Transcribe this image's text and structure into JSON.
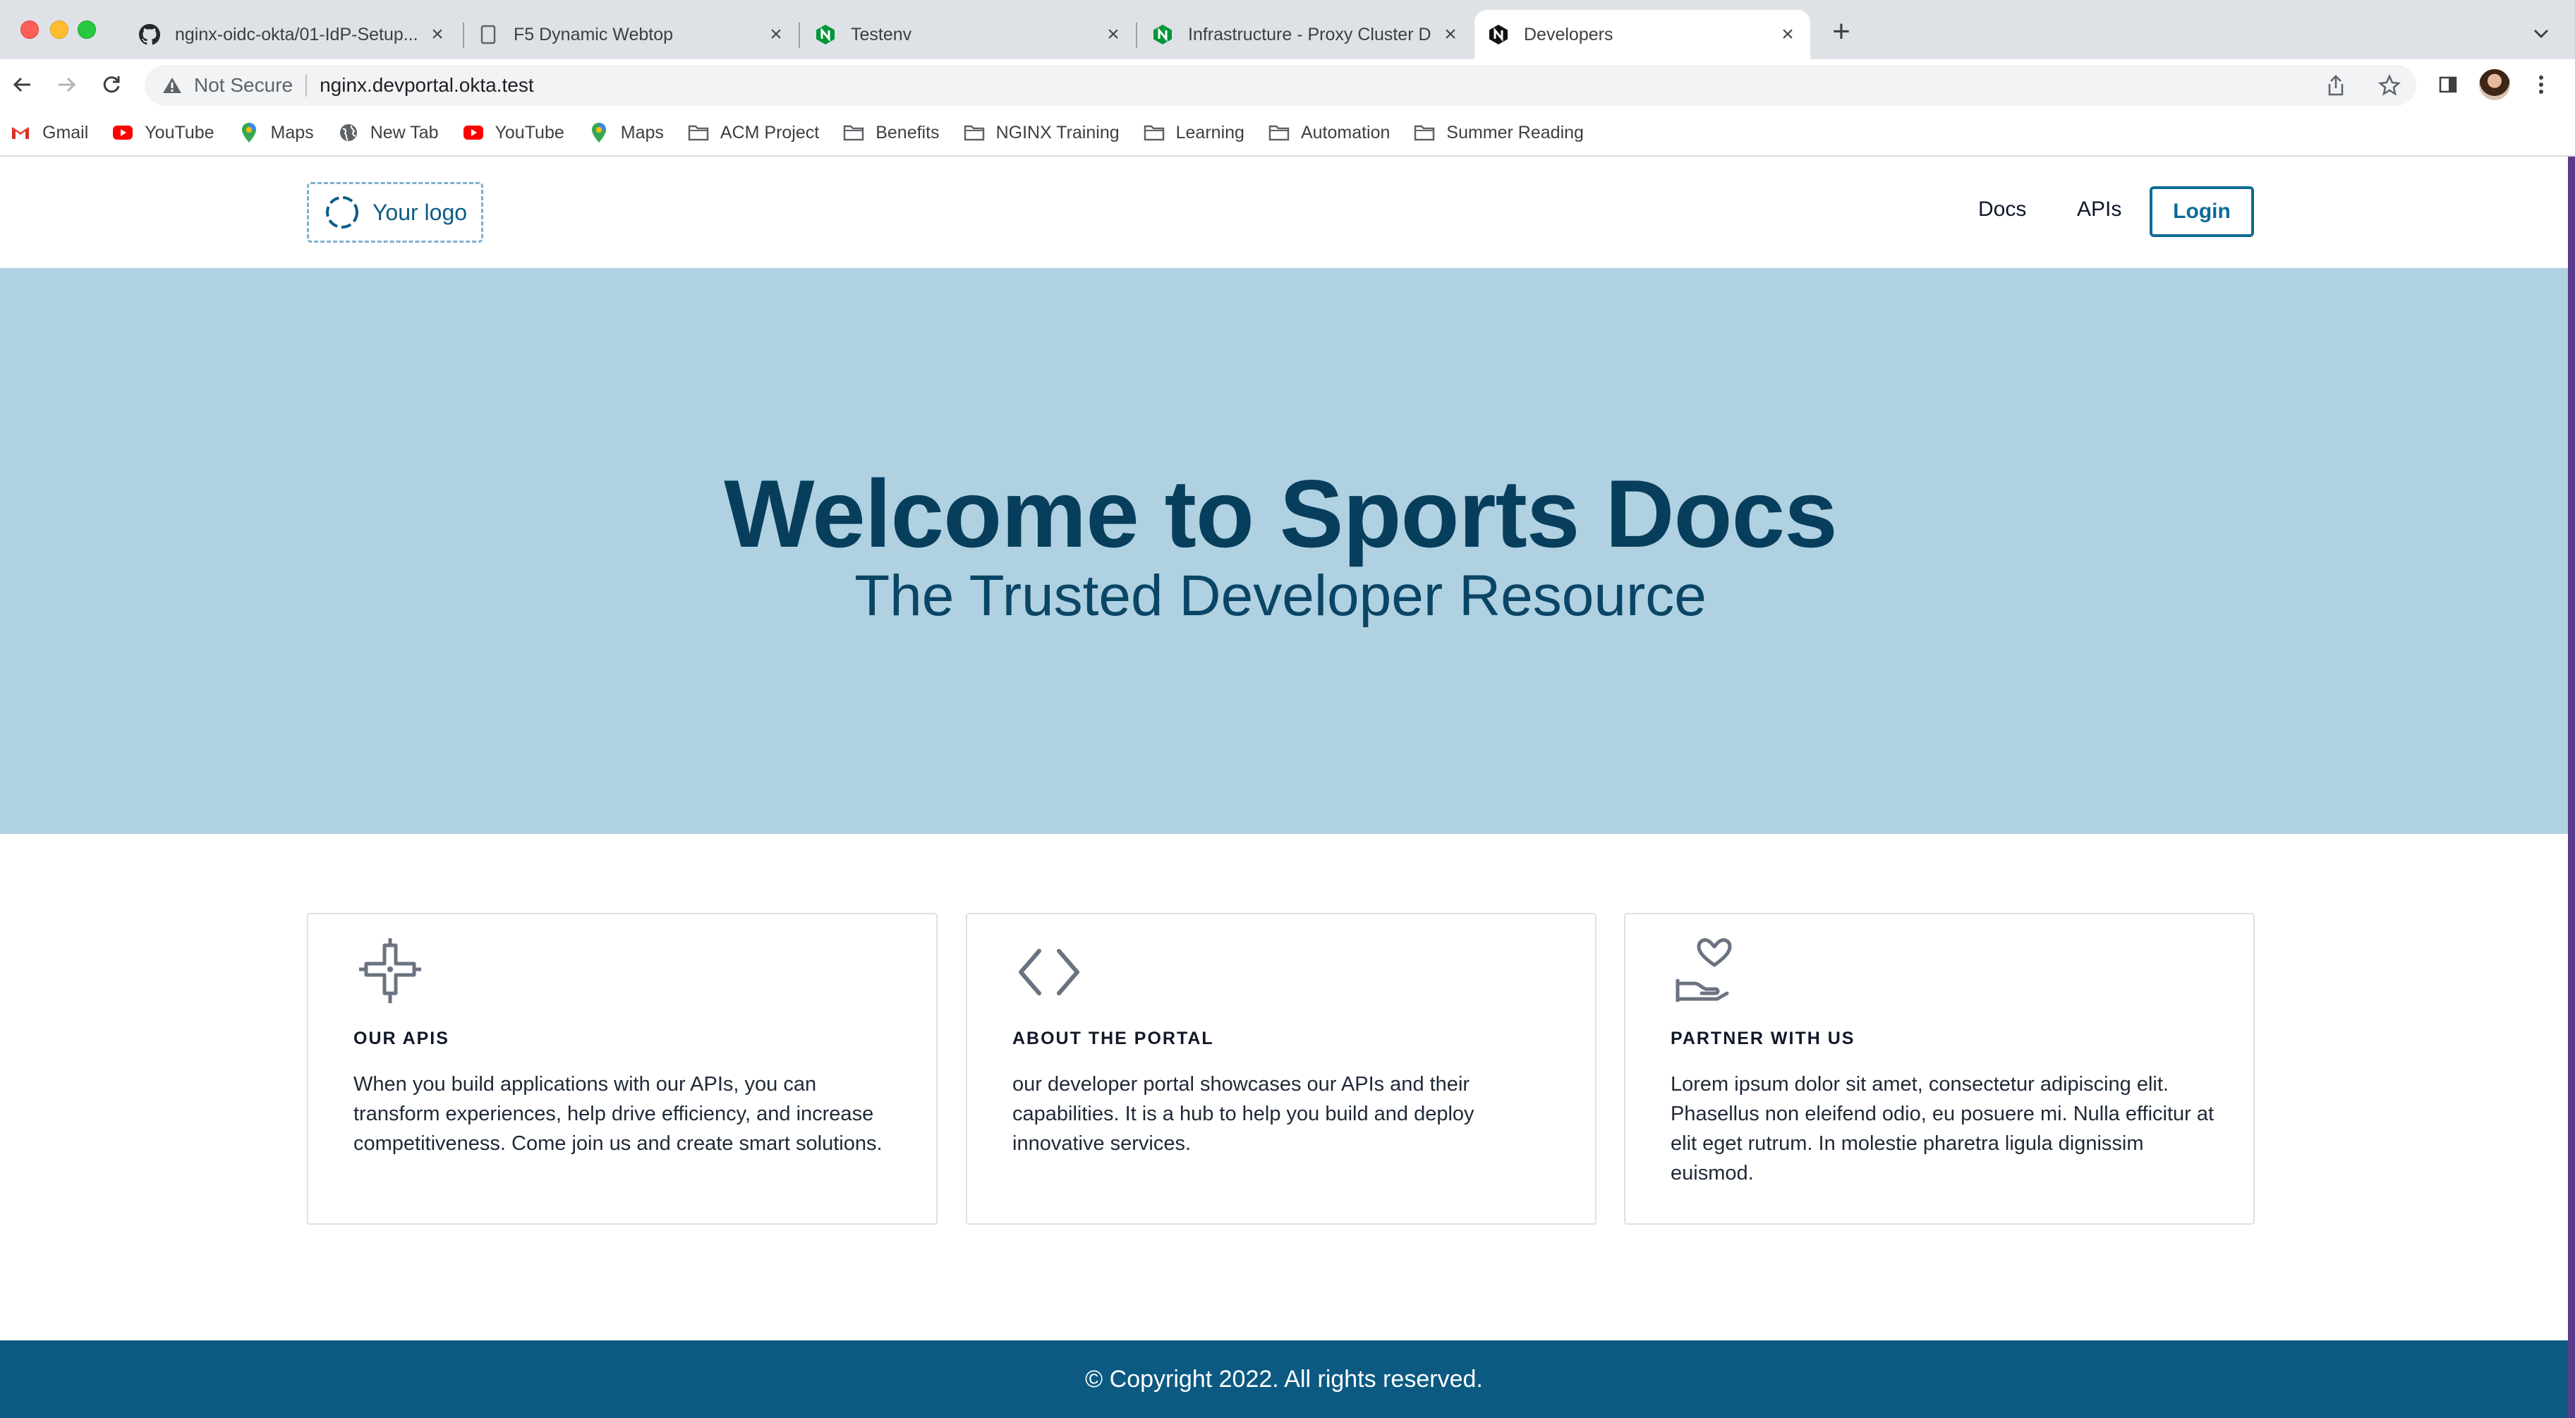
{
  "browser": {
    "tabs": [
      {
        "title": "nginx-oidc-okta/01-IdP-Setup...",
        "icon": "github-icon",
        "active": false
      },
      {
        "title": "F5 Dynamic Webtop",
        "icon": "document-icon",
        "active": false
      },
      {
        "title": "Testenv",
        "icon": "nginx-icon",
        "active": false
      },
      {
        "title": "Infrastructure - Proxy Cluster D",
        "icon": "nginx-icon",
        "active": false
      },
      {
        "title": "Developers",
        "icon": "nginx-dark-icon",
        "active": true
      }
    ],
    "address": {
      "security_label": "Not Secure",
      "url": "nginx.devportal.okta.test"
    },
    "bookmarks": [
      {
        "label": "Gmail",
        "icon": "gmail-icon"
      },
      {
        "label": "YouTube",
        "icon": "youtube-icon"
      },
      {
        "label": "Maps",
        "icon": "maps-icon"
      },
      {
        "label": "New Tab",
        "icon": "globe-icon"
      },
      {
        "label": "YouTube",
        "icon": "youtube-icon"
      },
      {
        "label": "Maps",
        "icon": "maps-icon"
      },
      {
        "label": "ACM Project",
        "icon": "folder-icon"
      },
      {
        "label": "Benefits",
        "icon": "folder-icon"
      },
      {
        "label": "NGINX Training",
        "icon": "folder-icon"
      },
      {
        "label": "Learning",
        "icon": "folder-icon"
      },
      {
        "label": "Automation",
        "icon": "folder-icon"
      },
      {
        "label": "Summer Reading",
        "icon": "folder-icon"
      }
    ]
  },
  "site": {
    "logo_text": "Your logo",
    "nav": {
      "docs": "Docs",
      "apis": "APIs",
      "login": "Login"
    },
    "hero": {
      "title": "Welcome to Sports Docs",
      "subtitle": "The Trusted Developer Resource"
    },
    "cards": [
      {
        "icon": "puzzle-cross-icon",
        "title": "OUR APIS",
        "body": "When you build applications with our APIs, you can transform experiences, help drive efficiency, and increase competitiveness. Come join us and create smart solutions."
      },
      {
        "icon": "code-brackets-icon",
        "title": "ABOUT THE PORTAL",
        "body": "our developer portal showcases our APIs and their capabilities. It is a hub to help you build and deploy innovative services."
      },
      {
        "icon": "hand-heart-icon",
        "title": "PARTNER WITH US",
        "body": "Lorem ipsum dolor sit amet, consectetur adipiscing elit. Phasellus non eleifend odio, eu posuere mi. Nulla efficitur at elit eget rutrum. In molestie pharetra ligula dignissim euismod."
      }
    ],
    "footer": "© Copyright 2022. All rights reserved."
  },
  "colors": {
    "hero_bg": "#afd1e1",
    "hero_text": "#073e5c",
    "accent": "#0d6a97",
    "footer_bg": "#0c5a82"
  }
}
